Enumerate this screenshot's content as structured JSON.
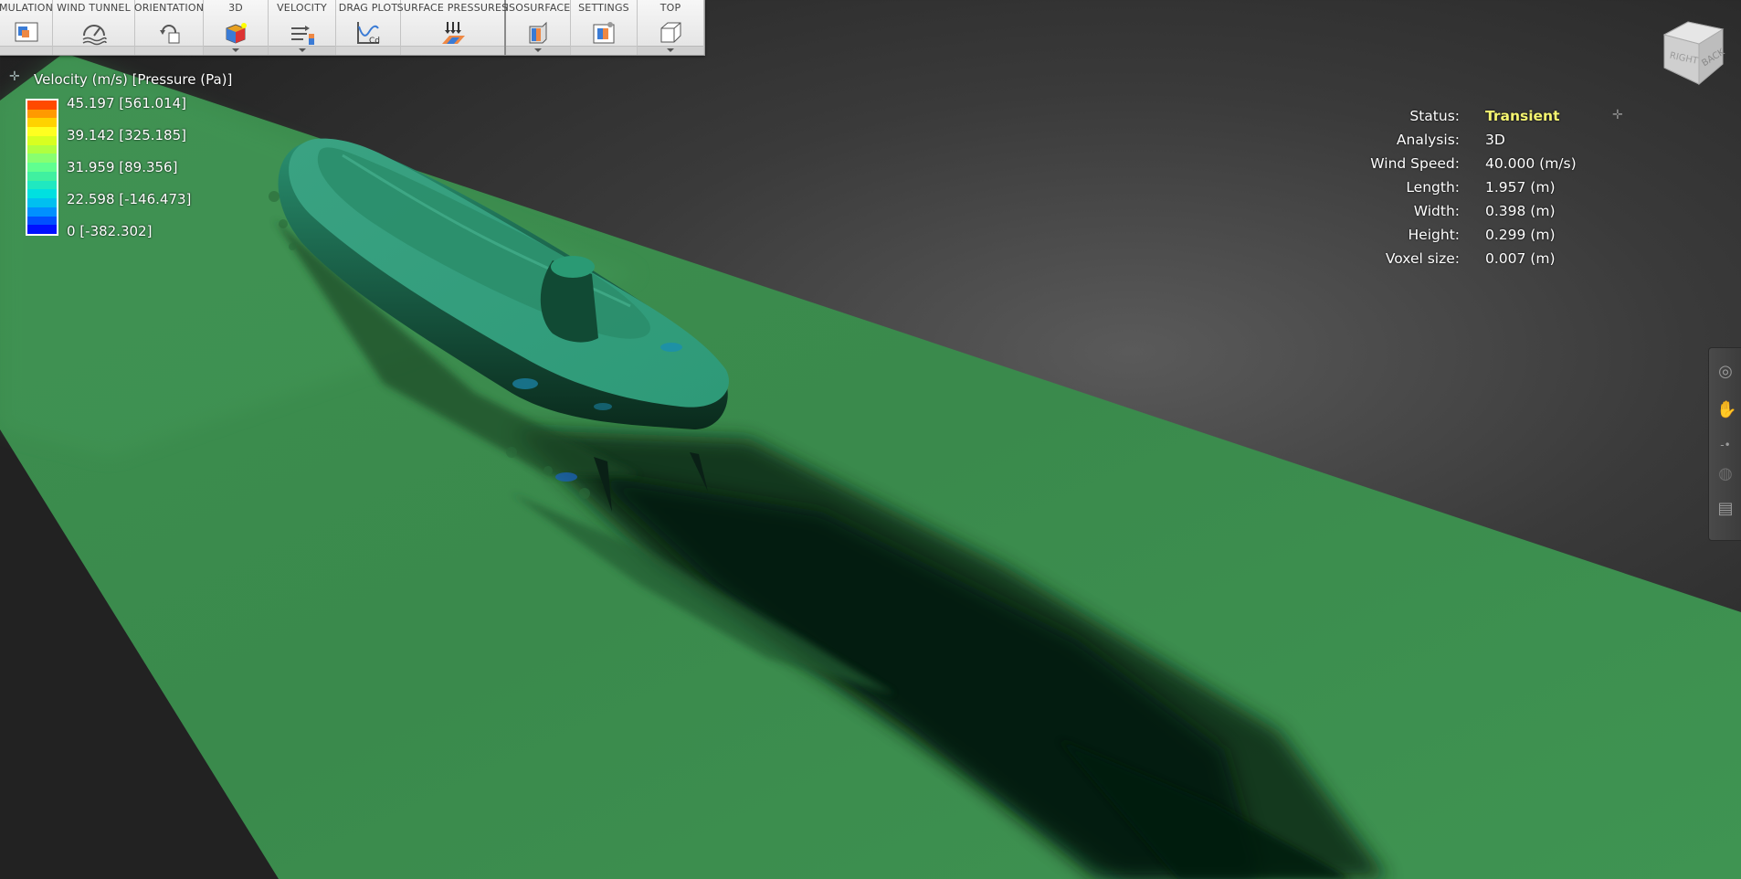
{
  "toolbar": {
    "items": [
      {
        "label": "MULATION",
        "icon": "simulation-icon"
      },
      {
        "label": "WIND TUNNEL",
        "icon": "wind-tunnel-icon"
      },
      {
        "label": "ORIENTATION",
        "icon": "orientation-icon"
      },
      {
        "label": "3D",
        "icon": "3d-results-icon"
      },
      {
        "label": "VELOCITY",
        "icon": "velocity-icon"
      },
      {
        "label": "DRAG PLOT",
        "icon": "drag-plot-icon"
      },
      {
        "label": "SURFACE PRESSURES",
        "icon": "surface-pressures-icon"
      },
      {
        "label": "ISOSURFACE",
        "icon": "isosurface-icon"
      },
      {
        "label": "SETTINGS",
        "icon": "settings-icon"
      },
      {
        "label": "TOP",
        "icon": "view-cube-top-icon"
      }
    ]
  },
  "legend": {
    "title": "Velocity (m/s) [Pressure (Pa)]",
    "labels": [
      "45.197 [561.014]",
      "39.142 [325.185]",
      "31.959 [89.356]",
      "22.598 [-146.473]",
      "0 [-382.302]"
    ],
    "colors": [
      "#ff4a00",
      "#ff9a00",
      "#ffd200",
      "#ffff20",
      "#d8ff20",
      "#b0ff40",
      "#88ff70",
      "#60ff90",
      "#40f0a0",
      "#20e8c0",
      "#00e0e0",
      "#00c0f0",
      "#0090ff",
      "#0050ff",
      "#0010ff"
    ]
  },
  "status": {
    "rows": [
      {
        "key": "Status:",
        "value": "Transient"
      },
      {
        "key": "Analysis:",
        "value": "3D"
      },
      {
        "key": "Wind Speed:",
        "value": "40.000 (m/s)"
      },
      {
        "key": "Length:",
        "value": "1.957 (m)"
      },
      {
        "key": "Width:",
        "value": "0.398 (m)"
      },
      {
        "key": "Height:",
        "value": "0.299 (m)"
      },
      {
        "key": "Voxel size:",
        "value": "0.007 (m)"
      }
    ],
    "highlight_color": "#f5f570"
  },
  "viewcube": {
    "faces": [
      "RIGHT",
      "BACK"
    ]
  },
  "navbar": {
    "icons": [
      "orbit-icon",
      "pan-icon",
      "zoom-slider-icon",
      "look-icon",
      "camera-icon"
    ]
  }
}
